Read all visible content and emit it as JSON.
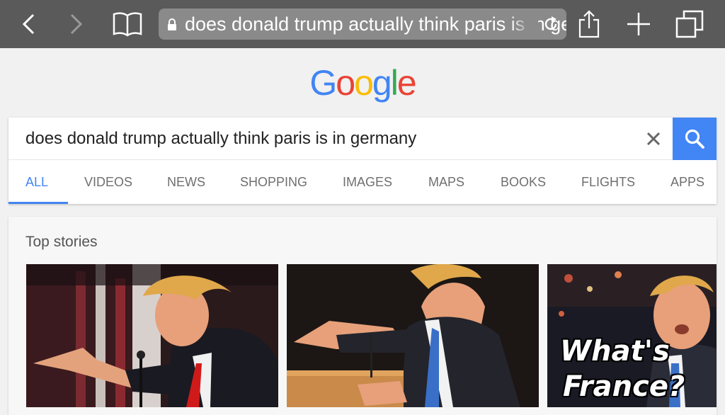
{
  "browser": {
    "url_text": "does donald trump actually think paris is in germany",
    "icons": [
      "back-icon",
      "forward-icon",
      "bookmarks-icon",
      "lock-icon",
      "reload-icon",
      "share-icon",
      "new-tab-icon",
      "tabs-icon"
    ]
  },
  "google": {
    "logo": [
      "G",
      "o",
      "o",
      "g",
      "l",
      "e"
    ],
    "logo_colors": [
      "#4285f4",
      "#ea4335",
      "#fbbc05",
      "#4285f4",
      "#34a853",
      "#ea4335"
    ]
  },
  "search": {
    "query": "does donald trump actually think paris is in germany",
    "accent": "#4285f4"
  },
  "tabs": [
    "ALL",
    "VIDEOS",
    "NEWS",
    "SHOPPING",
    "IMAGES",
    "MAPS",
    "BOOKS",
    "FLIGHTS",
    "APPS"
  ],
  "stories": {
    "title": "Top stories",
    "thumb3_caption_1": "What's",
    "thumb3_caption_2": "France?"
  }
}
